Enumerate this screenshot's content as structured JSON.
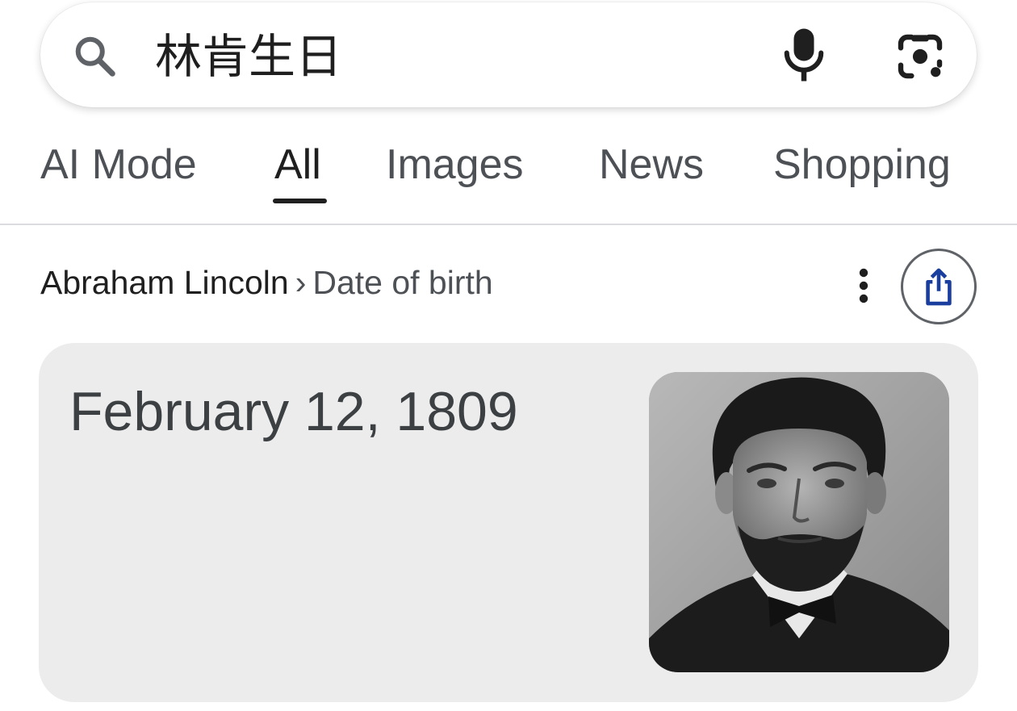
{
  "search": {
    "query": "林肯生日"
  },
  "tabs": [
    {
      "label": "AI Mode",
      "active": false
    },
    {
      "label": "All",
      "active": true
    },
    {
      "label": "Images",
      "active": false
    },
    {
      "label": "News",
      "active": false
    },
    {
      "label": "Shopping",
      "active": false
    }
  ],
  "breadcrumb": {
    "entity": "Abraham Lincoln",
    "separator": "›",
    "attribute": "Date of birth"
  },
  "answer": {
    "value": "February 12, 1809"
  },
  "icons": {
    "search": "search-icon",
    "mic": "microphone-icon",
    "lens": "google-lens-icon",
    "more": "more-vertical-icon",
    "share": "share-icon"
  },
  "colors": {
    "card_background": "#ececec",
    "share_arrow": "#1a3e9e",
    "tab_active": "#1f1f1f",
    "tab_inactive": "#4d5156"
  }
}
